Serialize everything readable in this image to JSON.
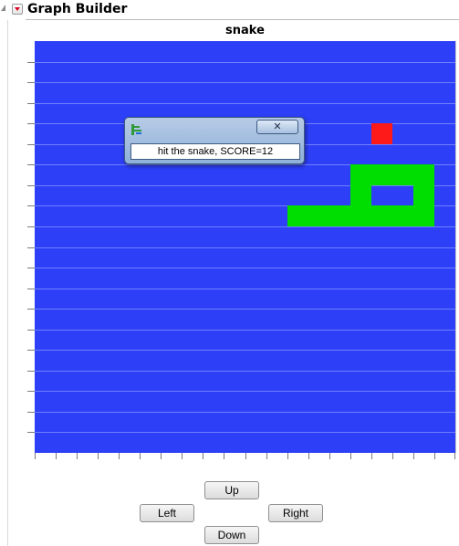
{
  "window": {
    "title": "Graph Builder"
  },
  "chart": {
    "title": "snake"
  },
  "colors": {
    "board": "#2d3ff7",
    "snake": "#00dd00",
    "food": "#ff1a1a",
    "gridline": "#6f80ff"
  },
  "grid": {
    "columns": 20,
    "rows": 20
  },
  "snake": {
    "cells": [
      [
        12,
        8
      ],
      [
        13,
        8
      ],
      [
        14,
        8
      ],
      [
        15,
        8
      ],
      [
        16,
        8
      ],
      [
        17,
        8
      ],
      [
        18,
        8
      ],
      [
        18,
        7
      ],
      [
        18,
        6
      ],
      [
        17,
        6
      ],
      [
        16,
        6
      ],
      [
        15,
        6
      ],
      [
        15,
        7
      ]
    ]
  },
  "food": {
    "cell": [
      16,
      4
    ]
  },
  "dialog": {
    "close_label": "✕",
    "message": "hit the snake, SCORE=12"
  },
  "controls": {
    "up_label": "Up",
    "left_label": "Left",
    "right_label": "Right",
    "down_label": "Down"
  },
  "icons": [
    "disclosure-icon",
    "red-menu-triangle-icon",
    "jmp-app-icon",
    "close-icon"
  ]
}
